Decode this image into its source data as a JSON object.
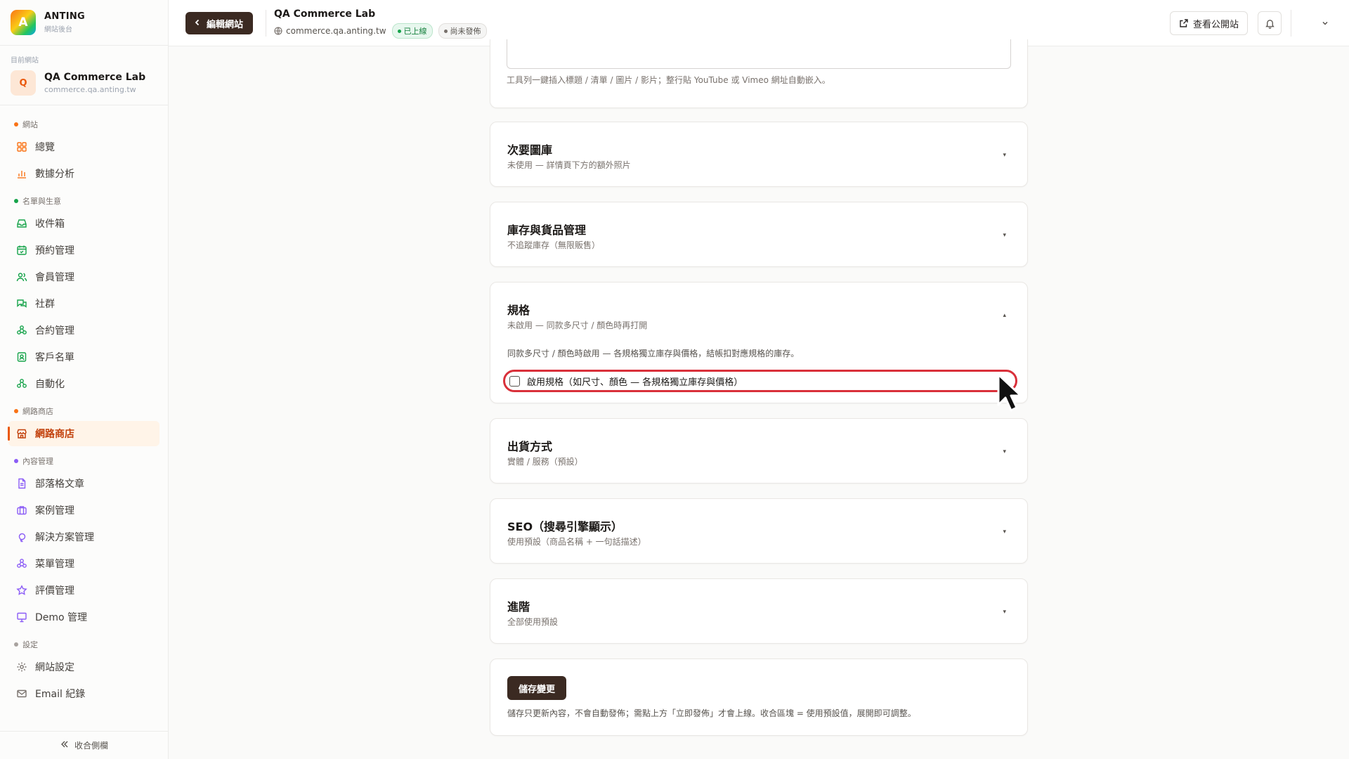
{
  "brand": {
    "logo_letter": "A",
    "name": "ANTING",
    "subtitle": "網站後台"
  },
  "current_site": {
    "label": "目前網站",
    "avatar_letter": "Q",
    "name": "QA Commerce Lab",
    "domain": "commerce.qa.anting.tw"
  },
  "sidebar": {
    "sections": [
      {
        "label": "網站",
        "color": "#f97316",
        "items": [
          {
            "label": "總覽",
            "icon": "grid-icon"
          },
          {
            "label": "數據分析",
            "icon": "bar-chart-icon"
          }
        ]
      },
      {
        "label": "名單與生意",
        "color": "#16a34a",
        "items": [
          {
            "label": "收件箱",
            "icon": "inbox-icon"
          },
          {
            "label": "預約管理",
            "icon": "calendar-icon"
          },
          {
            "label": "會員管理",
            "icon": "users-icon"
          },
          {
            "label": "社群",
            "icon": "chat-icon"
          },
          {
            "label": "合約管理",
            "icon": "network-icon"
          },
          {
            "label": "客戶名單",
            "icon": "contact-icon"
          },
          {
            "label": "自動化",
            "icon": "workflow-icon"
          }
        ]
      },
      {
        "label": "網路商店",
        "color": "#f97316",
        "items": [
          {
            "label": "網路商店",
            "icon": "store-icon",
            "active": true
          }
        ]
      },
      {
        "label": "內容管理",
        "color": "#8b5cf6",
        "items": [
          {
            "label": "部落格文章",
            "icon": "document-icon"
          },
          {
            "label": "案例管理",
            "icon": "briefcase-icon"
          },
          {
            "label": "解決方案管理",
            "icon": "lightbulb-icon"
          },
          {
            "label": "菜單管理",
            "icon": "menu-icon"
          },
          {
            "label": "評價管理",
            "icon": "star-icon"
          },
          {
            "label": "Demo 管理",
            "icon": "presentation-icon"
          }
        ]
      },
      {
        "label": "設定",
        "color": "#a8a29e",
        "items": [
          {
            "label": "網站設定",
            "icon": "gear-icon"
          },
          {
            "label": "Email 紀錄",
            "icon": "mail-icon"
          }
        ]
      }
    ],
    "collapse_label": "收合側欄"
  },
  "topbar": {
    "edit_label": "編輯網站",
    "site_name": "QA Commerce Lab",
    "site_domain": "commerce.qa.anting.tw",
    "status_live": "已上線",
    "status_draft": "尚未發佈",
    "view_public_label": "查看公開站"
  },
  "editor": {
    "hint": "工具列一鍵插入標題 / 清單 / 圖片 / 影片；整行貼 YouTube 或 Vimeo 網址自動嵌入。"
  },
  "sections": {
    "gallery": {
      "title": "次要圖庫",
      "subtitle": "未使用 — 詳情頁下方的額外照片"
    },
    "inventory": {
      "title": "庫存與貨品管理",
      "subtitle": "不追蹤庫存（無限販售）"
    },
    "variants": {
      "title": "規格",
      "subtitle": "未啟用 — 同款多尺寸 / 顏色時再打開",
      "description": "同款多尺寸 / 顏色時啟用 — 各規格獨立庫存與價格，結帳扣對應規格的庫存。",
      "checkbox_label": "啟用規格（如尺寸、顏色 — 各規格獨立庫存與價格）",
      "checkbox_checked": false
    },
    "shipping": {
      "title": "出貨方式",
      "subtitle": "實體 / 服務（預設）"
    },
    "seo": {
      "title": "SEO（搜尋引擎顯示）",
      "subtitle": "使用預設（商品名稱 + 一句話描述）"
    },
    "advanced": {
      "title": "進階",
      "subtitle": "全部使用預設"
    }
  },
  "save": {
    "button_label": "儲存變更",
    "note": "儲存只更新內容，不會自動發佈；需點上方「立即發佈」才會上線。收合區塊 = 使用預設值，展開即可調整。"
  }
}
